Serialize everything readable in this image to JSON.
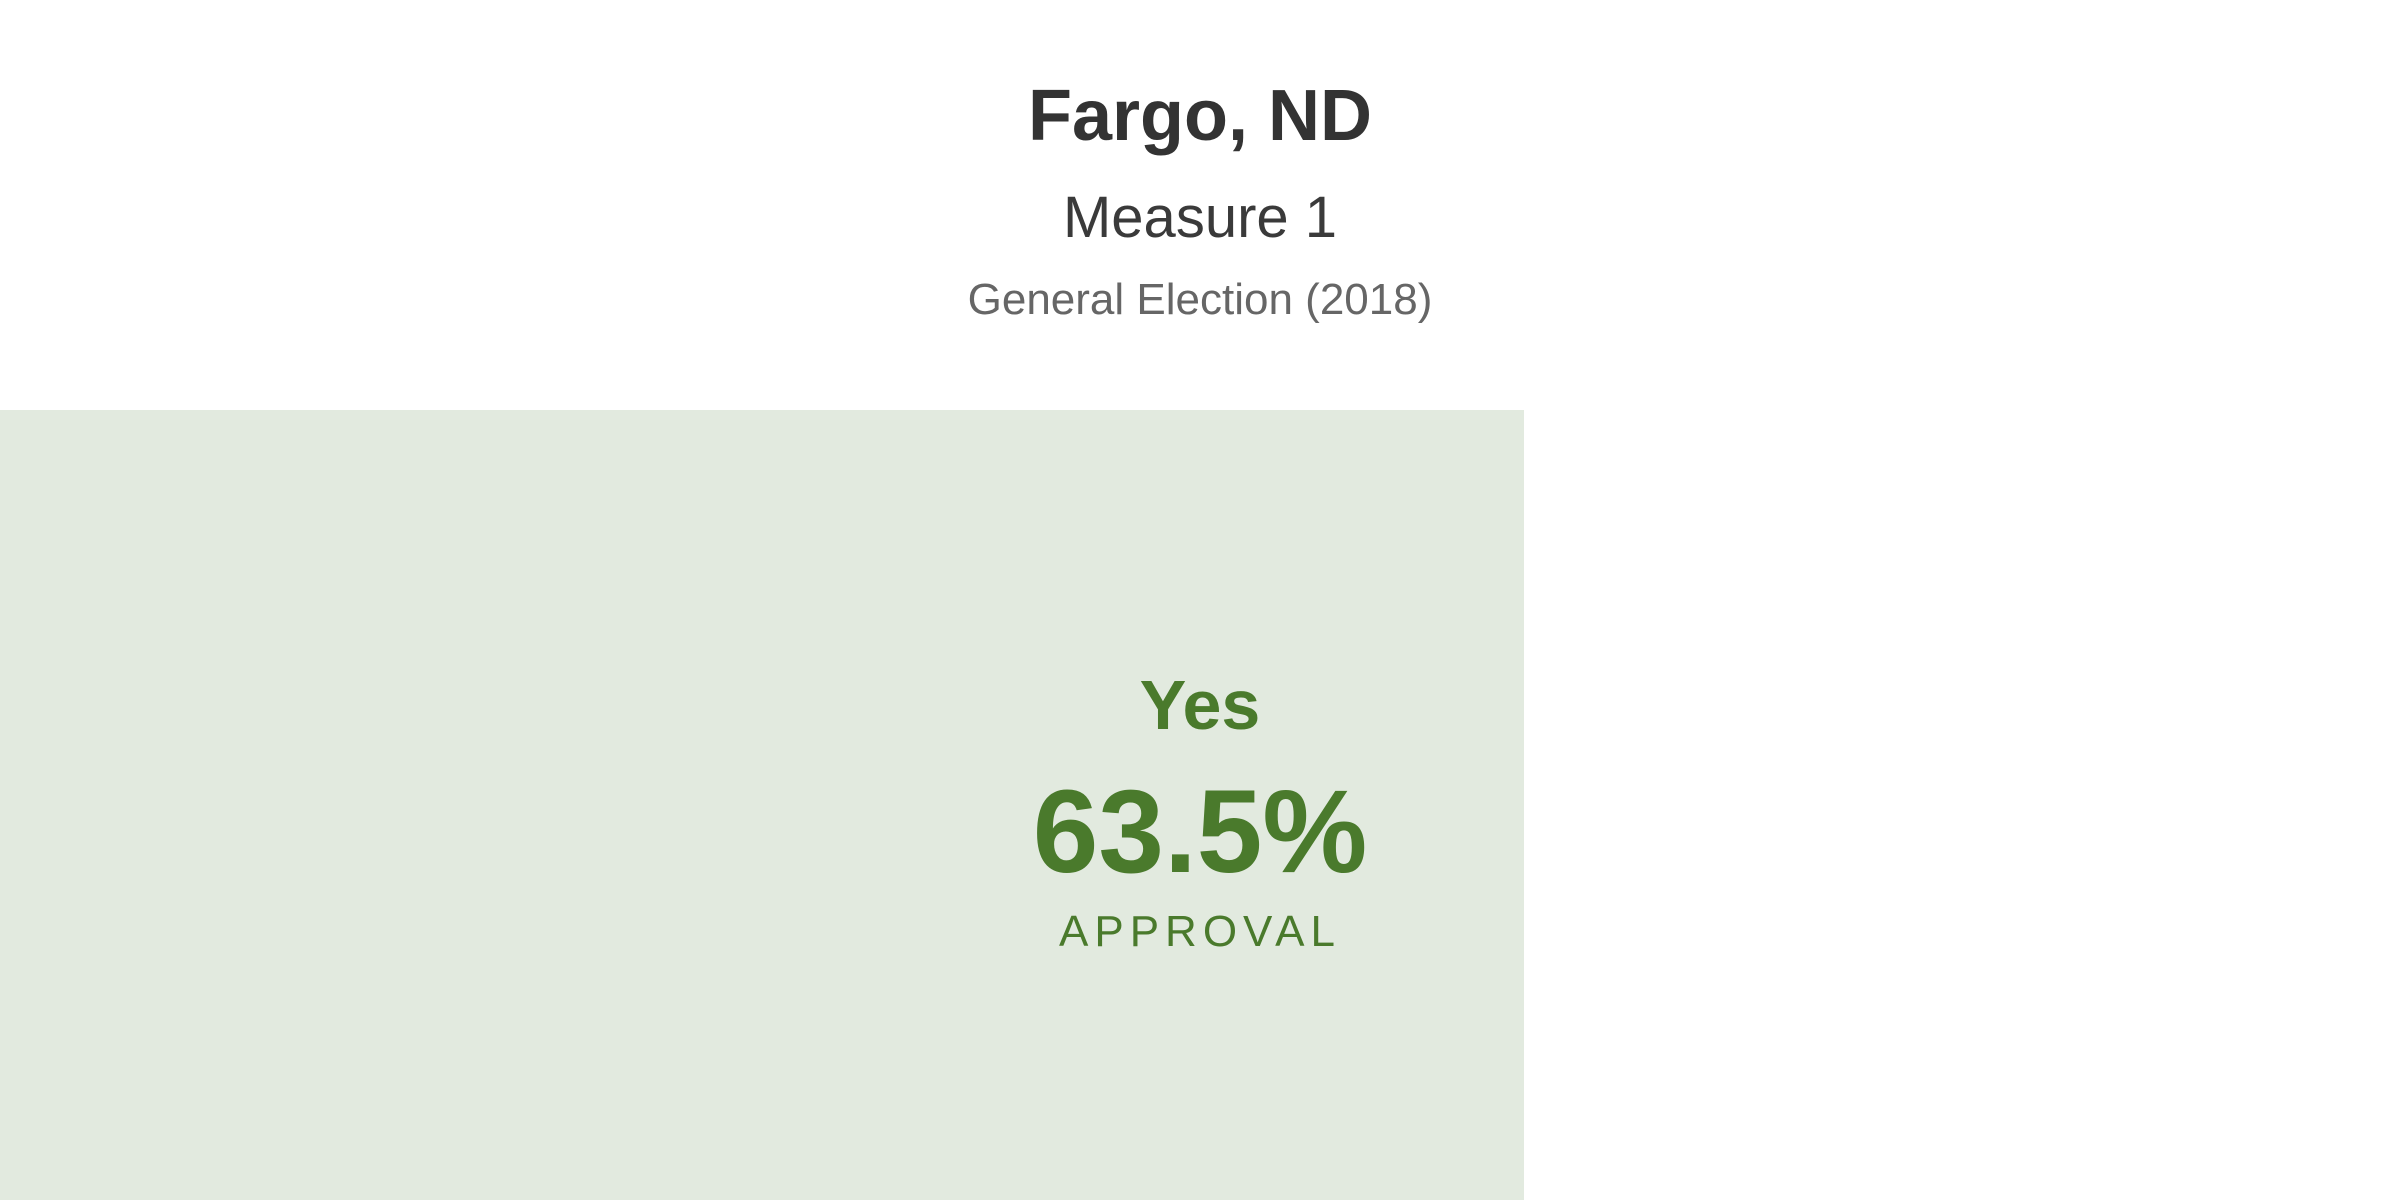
{
  "header": {
    "location": "Fargo, ND",
    "measure": "Measure 1",
    "election": "General Election (2018)"
  },
  "result": {
    "label": "Yes",
    "percent_text": "63.5%",
    "percent_value": 63.5,
    "caption": "APPROVAL"
  },
  "colors": {
    "fill": "#e2eadf",
    "accent": "#4a7a2c",
    "title": "#333333",
    "secondary": "#666666"
  }
}
